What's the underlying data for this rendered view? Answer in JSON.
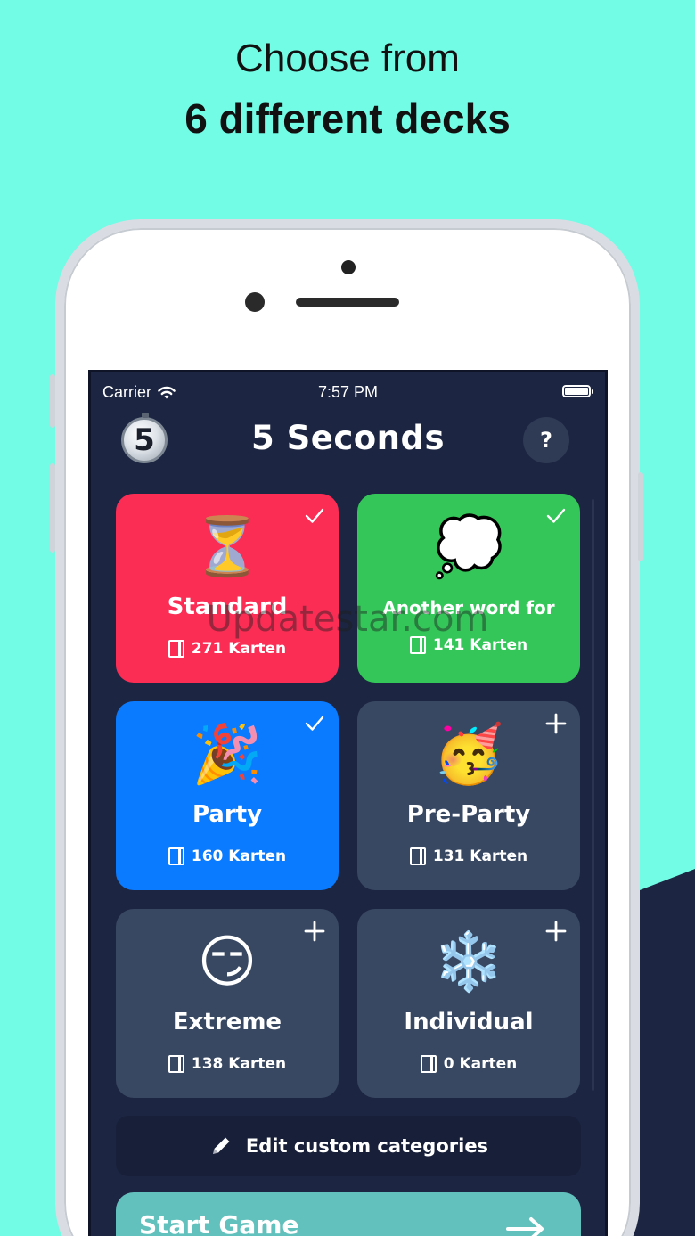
{
  "headline": {
    "line1": "Choose from",
    "line2": "6 different decks"
  },
  "status_bar": {
    "carrier": "Carrier",
    "time": "7:57 PM"
  },
  "app": {
    "logo_text": "5",
    "title": "5 Seconds",
    "help_label": "?"
  },
  "decks": [
    {
      "emoji": "⏳",
      "title": "Standard",
      "count": "271 Karten",
      "state": "selected",
      "color": "#fb2d55"
    },
    {
      "emoji": "💭",
      "title": "Another word for",
      "count": "141 Karten",
      "state": "selected",
      "color": "#34c659"
    },
    {
      "emoji": "🎉",
      "title": "Party",
      "count": "160 Karten",
      "state": "selected",
      "color": "#0a7bff"
    },
    {
      "emoji": "🥳",
      "title": "Pre-Party",
      "count": "131 Karten",
      "state": "add",
      "color": "#384862"
    },
    {
      "emoji": "😏",
      "title": "Extreme",
      "count": "138 Karten",
      "state": "add",
      "color": "#384862"
    },
    {
      "emoji": "❄️",
      "title": "Individual",
      "count": "0 Karten",
      "state": "add",
      "color": "#384862"
    }
  ],
  "edit_button": {
    "label": "Edit custom categories"
  },
  "start_button": {
    "label": "Start Game"
  },
  "watermark": "Updatestar.com",
  "colors": {
    "background": "#72fbe5",
    "screen": "#1c2541",
    "accent_teal": "#63c1bd"
  }
}
